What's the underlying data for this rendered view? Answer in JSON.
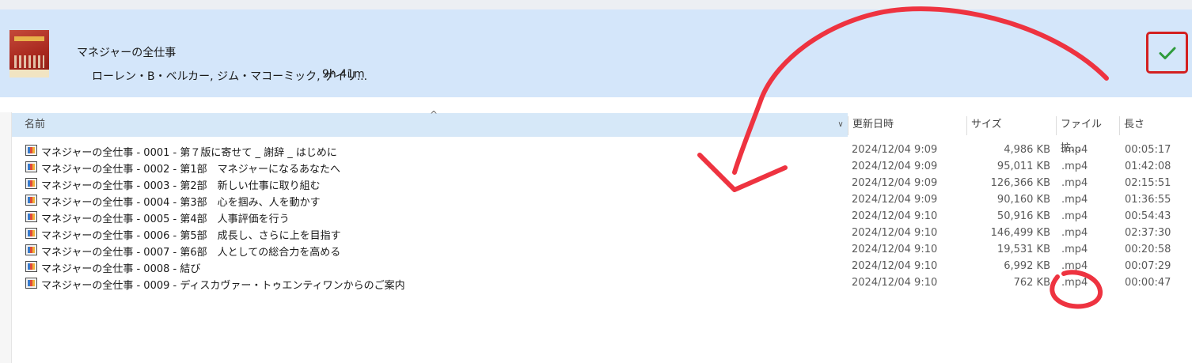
{
  "book": {
    "title": "マネジャーの全仕事",
    "authors": "ローレン・B・ベルカー, ジム・マコーミック, ゲイリ...",
    "duration": "9h 41m"
  },
  "columns": {
    "name": "名前",
    "date": "更新日時",
    "size": "サイズ",
    "ext": "ファイル拡...",
    "length": "長さ"
  },
  "files": [
    {
      "name": "マネジャーの全仕事 - 0001 - 第７版に寄せて _ 謝辞 _ はじめに",
      "date": "2024/12/04 9:09",
      "size": "4,986 KB",
      "ext": ".mp4",
      "length": "00:05:17"
    },
    {
      "name": "マネジャーの全仕事 - 0002 - 第1部　マネジャーになるあなたへ",
      "date": "2024/12/04 9:09",
      "size": "95,011 KB",
      "ext": ".mp4",
      "length": "01:42:08"
    },
    {
      "name": "マネジャーの全仕事 - 0003 - 第2部　新しい仕事に取り組む",
      "date": "2024/12/04 9:09",
      "size": "126,366 KB",
      "ext": ".mp4",
      "length": "02:15:51"
    },
    {
      "name": "マネジャーの全仕事 - 0004 - 第3部　心を掴み、人を動かす",
      "date": "2024/12/04 9:09",
      "size": "90,160 KB",
      "ext": ".mp4",
      "length": "01:36:55"
    },
    {
      "name": "マネジャーの全仕事 - 0005 - 第4部　人事評価を行う",
      "date": "2024/12/04 9:10",
      "size": "50,916 KB",
      "ext": ".mp4",
      "length": "00:54:43"
    },
    {
      "name": "マネジャーの全仕事 - 0006 - 第5部　成長し、さらに上を目指す",
      "date": "2024/12/04 9:10",
      "size": "146,499 KB",
      "ext": ".mp4",
      "length": "02:37:30"
    },
    {
      "name": "マネジャーの全仕事 - 0007 - 第6部　人としての総合力を高める",
      "date": "2024/12/04 9:10",
      "size": "19,531 KB",
      "ext": ".mp4",
      "length": "00:20:58"
    },
    {
      "name": "マネジャーの全仕事 - 0008 - 結び",
      "date": "2024/12/04 9:10",
      "size": "6,992 KB",
      "ext": ".mp4",
      "length": "00:07:29"
    },
    {
      "name": "マネジャーの全仕事 - 0009 - ディスカヴァー・トゥエンティワンからのご案内",
      "date": "2024/12/04 9:10",
      "size": "762 KB",
      "ext": ".mp4",
      "length": "00:00:47"
    }
  ],
  "colors": {
    "banner": "#d4e6fa",
    "annotation": "#ee3340",
    "check": "#2e9b3c"
  }
}
